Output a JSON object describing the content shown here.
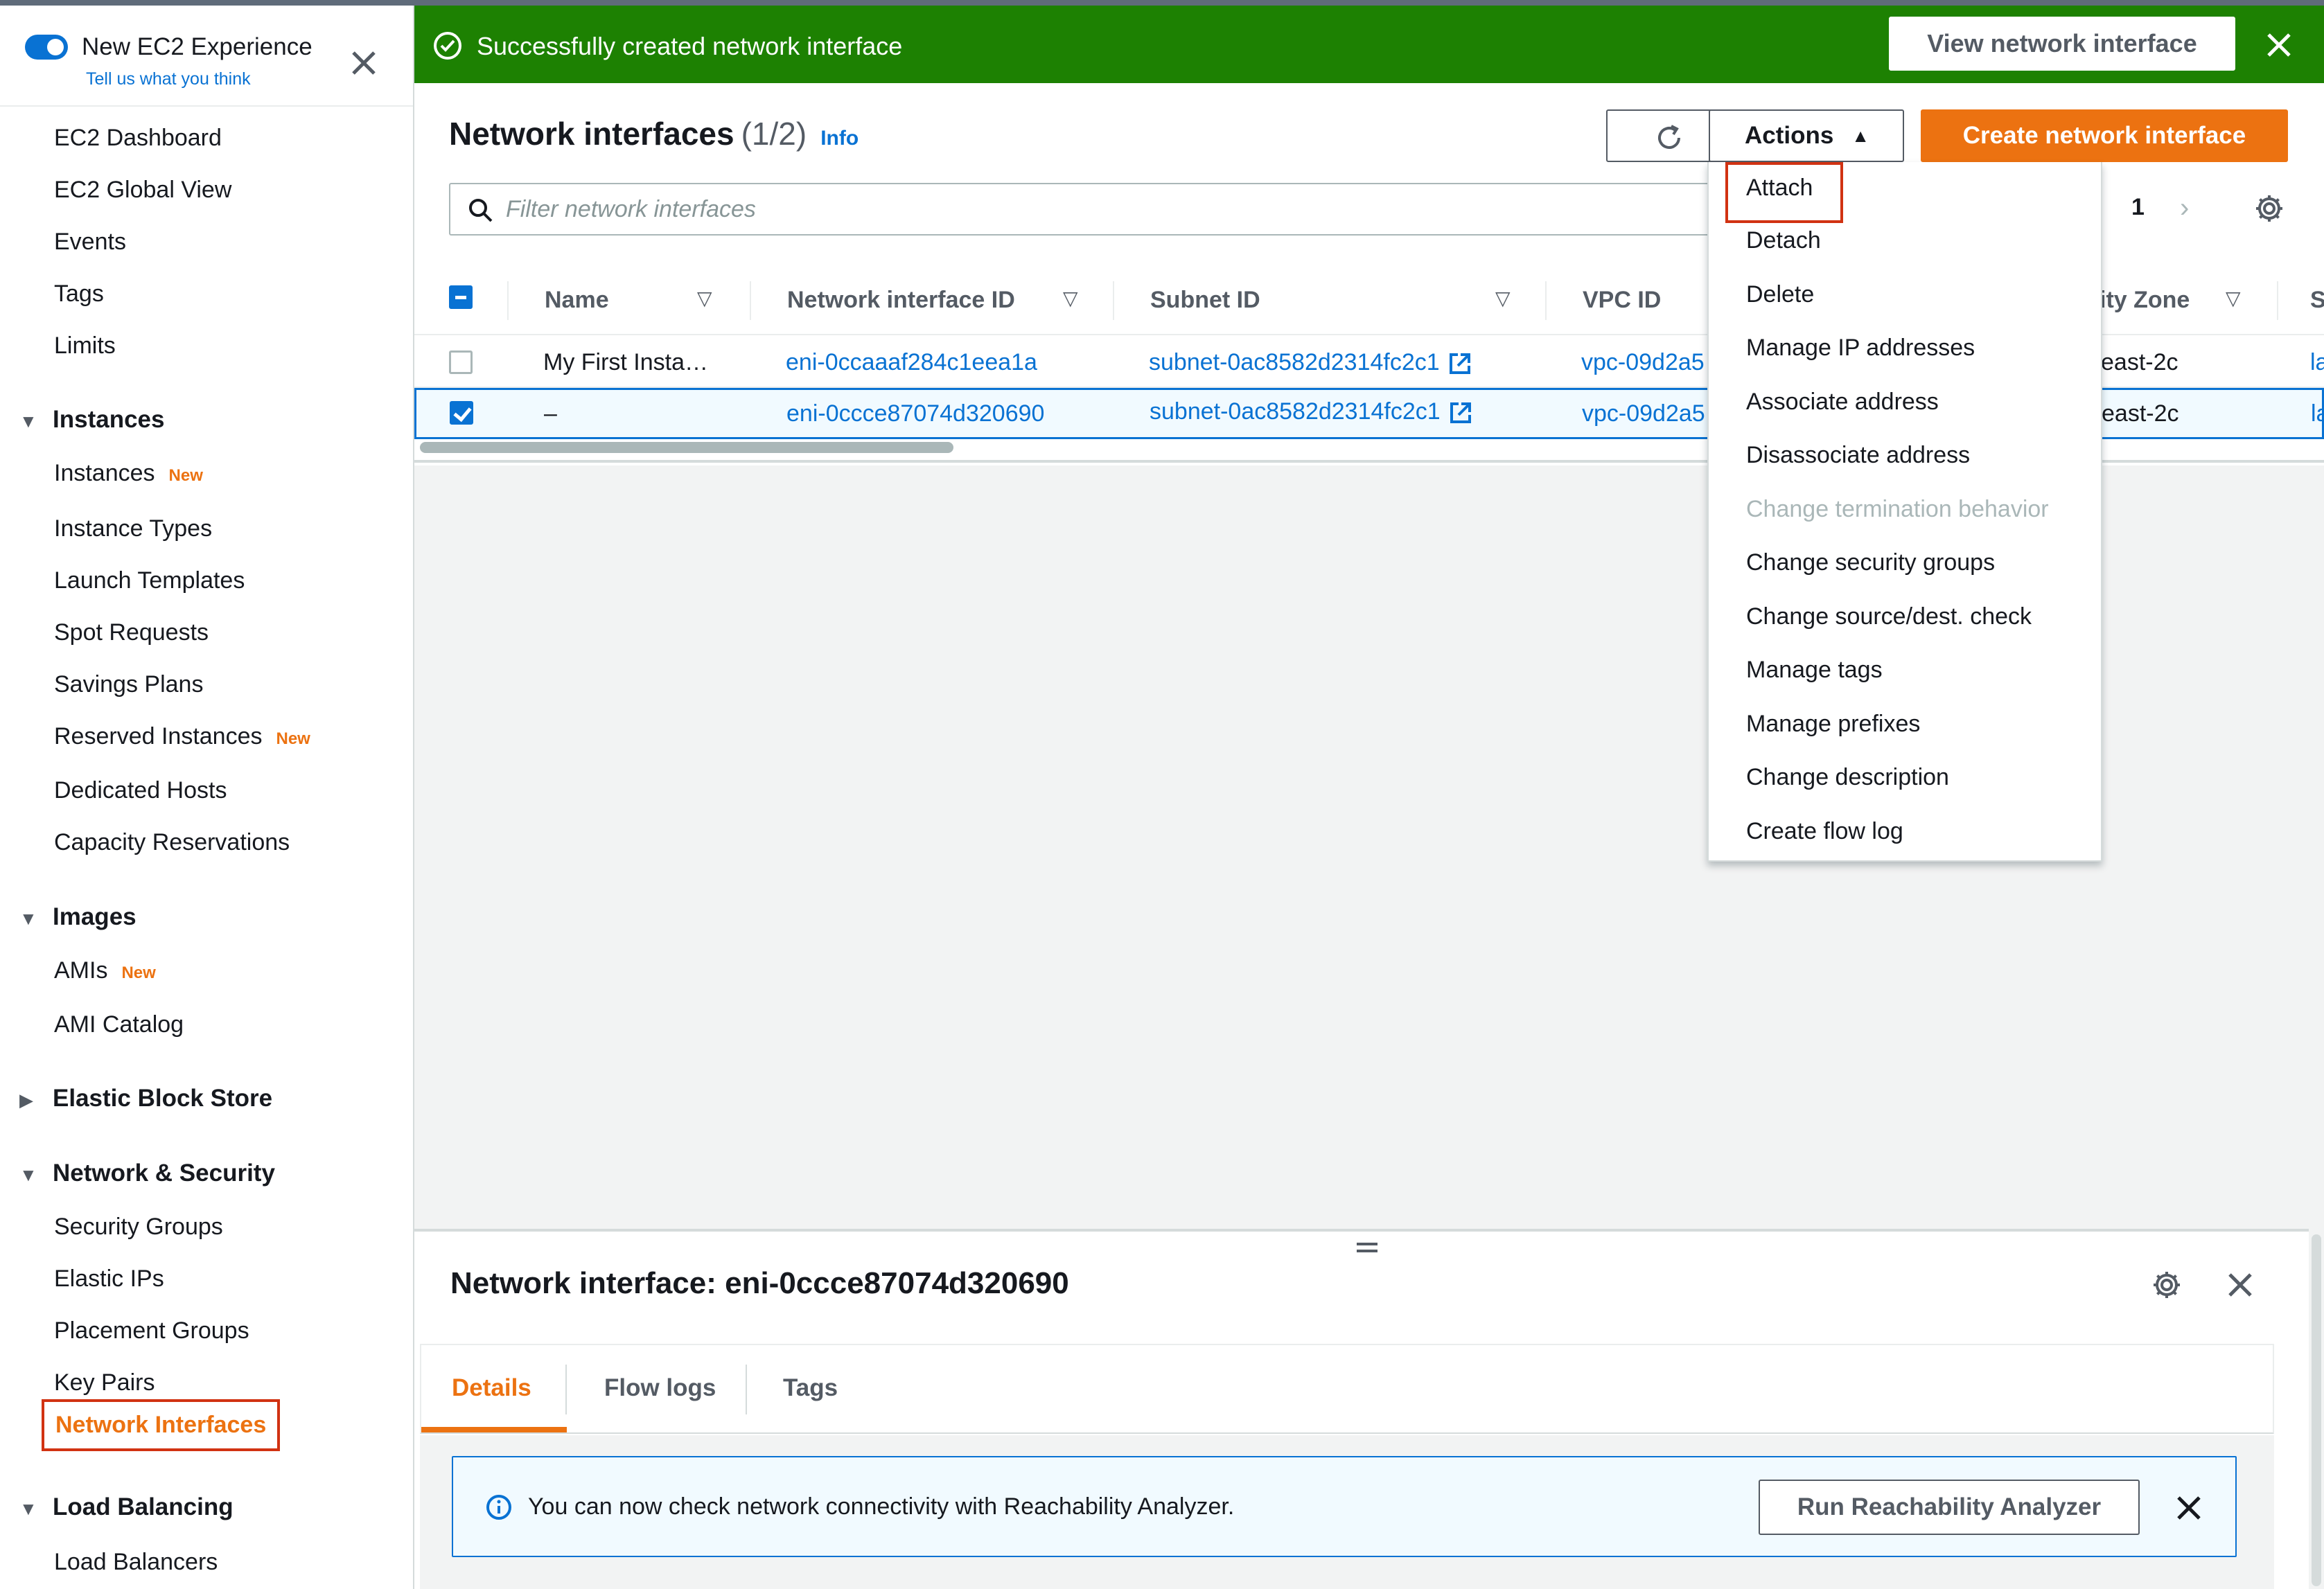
{
  "sidebar": {
    "experience_title": "New EC2 Experience",
    "experience_sub": "Tell us what you think",
    "top_items": [
      "EC2 Dashboard",
      "EC2 Global View",
      "Events",
      "Tags",
      "Limits"
    ],
    "sections": {
      "instances": "Instances",
      "images": "Images",
      "ebs": "Elastic Block Store",
      "network": "Network & Security",
      "lb": "Load Balancing"
    },
    "instances_items": {
      "instances": "Instances",
      "instance_types": "Instance Types",
      "launch_templates": "Launch Templates",
      "spot_requests": "Spot Requests",
      "savings_plans": "Savings Plans",
      "reserved_instances": "Reserved Instances",
      "dedicated_hosts": "Dedicated Hosts",
      "capacity_reservations": "Capacity Reservations"
    },
    "images_items": {
      "amis": "AMIs",
      "ami_catalog": "AMI Catalog"
    },
    "network_items": {
      "security_groups": "Security Groups",
      "elastic_ips": "Elastic IPs",
      "placement_groups": "Placement Groups",
      "key_pairs": "Key Pairs",
      "network_interfaces": "Network Interfaces"
    },
    "lb_items": {
      "load_balancers": "Load Balancers"
    },
    "new_badge": "New"
  },
  "flash": {
    "message": "Successfully created network interface",
    "button": "View network interface",
    "color": "#1d8102"
  },
  "header": {
    "title": "Network interfaces",
    "count": "(1/2)",
    "info": "Info",
    "actions_label": "Actions",
    "create_label": "Create network interface",
    "filter_placeholder": "Filter network interfaces",
    "page": "1"
  },
  "table": {
    "columns": [
      "Name",
      "Network interface ID",
      "Subnet ID",
      "VPC ID",
      "ity Zone",
      "S"
    ],
    "rows": [
      {
        "name": "My First Insta…",
        "eni": "eni-0ccaaaf284c1eea1a",
        "subnet": "subnet-0ac8582d2314fc2c1",
        "vpc": "vpc-09d2a5",
        "az": "east-2c",
        "sec": "la",
        "selected": false
      },
      {
        "name": "–",
        "eni": "eni-0ccce87074d320690",
        "subnet": "subnet-0ac8582d2314fc2c1",
        "vpc": "vpc-09d2a5",
        "az": "east-2c",
        "sec": "la",
        "selected": true
      }
    ]
  },
  "actions_menu": {
    "attach": "Attach",
    "detach": "Detach",
    "delete": "Delete",
    "manage_ip": "Manage IP addresses",
    "associate": "Associate address",
    "disassociate": "Disassociate address",
    "termination": "Change termination behavior",
    "security_groups": "Change security groups",
    "source_dest": "Change source/dest. check",
    "tags": "Manage tags",
    "prefixes": "Manage prefixes",
    "description": "Change description",
    "flow_log": "Create flow log"
  },
  "details": {
    "title": "Network interface: eni-0ccce87074d320690",
    "tabs": [
      "Details",
      "Flow logs",
      "Tags"
    ],
    "alert_text": "You can now check network connectivity with Reachability Analyzer.",
    "alert_button": "Run Reachability Analyzer"
  },
  "colors": {
    "accent": "#ec7211",
    "link": "#0972d3",
    "highlight_box": "#d13212"
  }
}
